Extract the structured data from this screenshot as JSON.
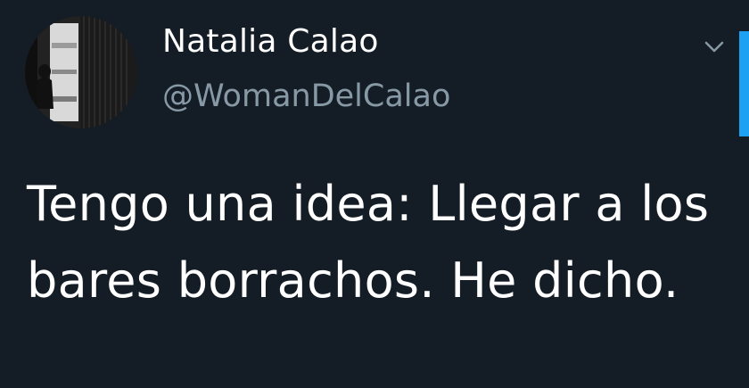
{
  "user": {
    "display_name": "Natalia Calao",
    "handle": "@WomanDelCalao"
  },
  "tweet": {
    "text": "Tengo una idea: Llegar a los bares borrachos. He dicho."
  },
  "icons": {
    "menu": "chevron-down-icon",
    "avatar": "profile-photo"
  },
  "colors": {
    "background": "#141d26",
    "primary_text": "#ffffff",
    "secondary_text": "#8899a6",
    "accent": "#1da1f2"
  }
}
